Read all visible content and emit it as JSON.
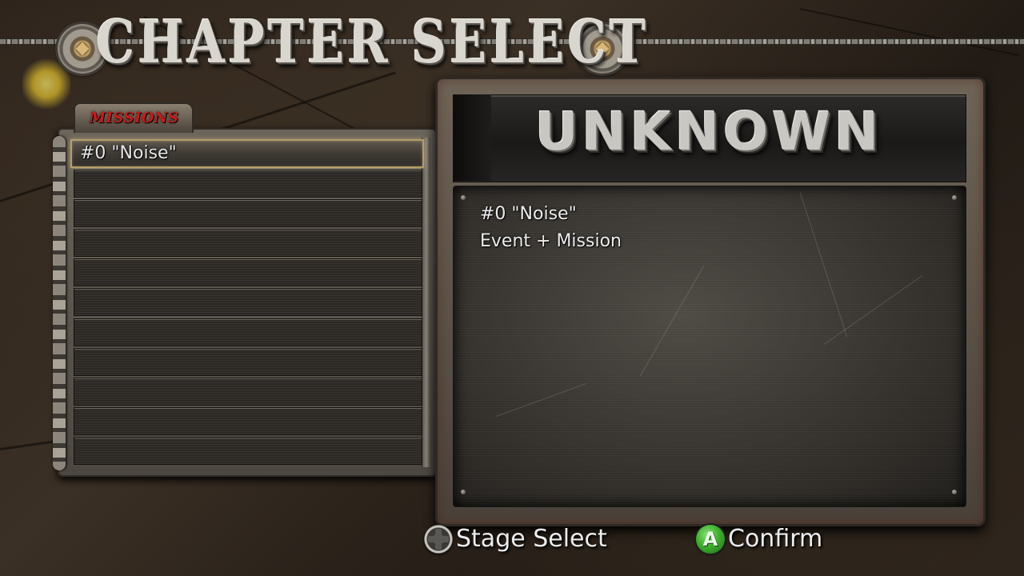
{
  "header": {
    "title": "CHAPTER SELECT",
    "left_gear_icon": "gear-icon",
    "right_gear_icon": "gear-icon"
  },
  "missions": {
    "tab_label": "MISSIONS",
    "tab_color": "#c21d1d",
    "selected_index": 0,
    "items": [
      {
        "label": "#0 \"Noise\""
      },
      {
        "label": ""
      },
      {
        "label": ""
      },
      {
        "label": ""
      },
      {
        "label": ""
      },
      {
        "label": ""
      },
      {
        "label": ""
      },
      {
        "label": ""
      },
      {
        "label": ""
      },
      {
        "label": ""
      },
      {
        "label": ""
      }
    ]
  },
  "detail": {
    "title": "UNKNOWN",
    "mission_name": "#0 \"Noise\"",
    "mission_type": "Event + Mission"
  },
  "prompts": {
    "stage_select": {
      "icon": "dpad-icon",
      "label": "Stage Select"
    },
    "confirm": {
      "icon": "a-button-icon",
      "glyph": "A",
      "label": "Confirm",
      "color": "#3fae2f"
    }
  }
}
